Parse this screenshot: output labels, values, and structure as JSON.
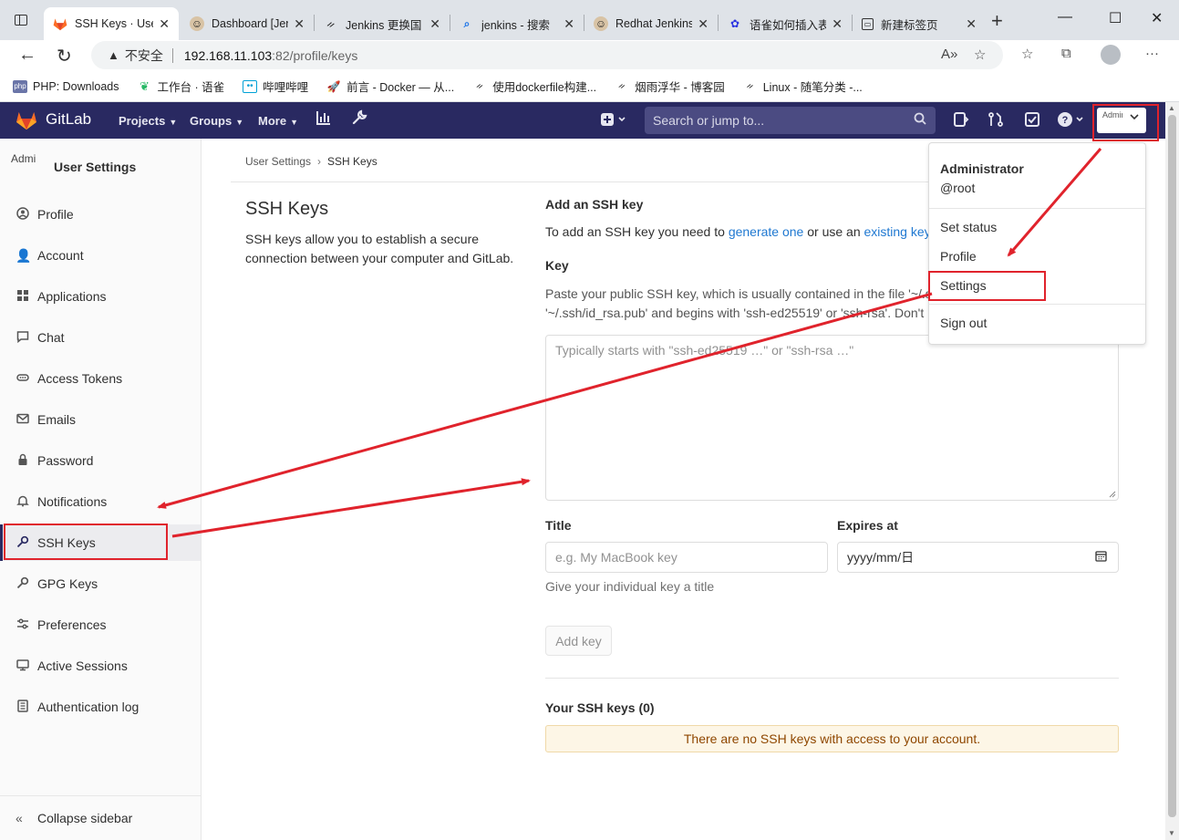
{
  "browser": {
    "tabs": [
      {
        "title": "SSH Keys · User",
        "icon": "gitlab-icon",
        "active": true
      },
      {
        "title": "Dashboard [Jen",
        "icon": "jenkins-icon",
        "active": false
      },
      {
        "title": "Jenkins 更换国",
        "icon": "yuque-icon",
        "active": false
      },
      {
        "title": "jenkins - 搜索",
        "icon": "search-icon",
        "active": false
      },
      {
        "title": "Redhat Jenkins",
        "icon": "jenkins-icon",
        "active": false
      },
      {
        "title": "语雀如何插入表",
        "icon": "baidu-icon",
        "active": false
      },
      {
        "title": "新建标签页",
        "icon": "newtab-icon",
        "active": false
      }
    ],
    "insecure_label": "不安全",
    "url_host": "192.168.11.103",
    "url_path": ":82/profile/keys",
    "bookmarks": [
      {
        "label": "PHP: Downloads",
        "icon": "php-icon"
      },
      {
        "label": "工作台 · 语雀",
        "icon": "yuque-icon"
      },
      {
        "label": "哔哩哔哩",
        "icon": "bilibili-icon"
      },
      {
        "label": "前言 - Docker — 从...",
        "icon": "rocket-icon"
      },
      {
        "label": "使用dockerfile构建...",
        "icon": "yuque-icon"
      },
      {
        "label": "烟雨浮华 - 博客园",
        "icon": "yuque-icon"
      },
      {
        "label": "Linux - 随笔分类 -...",
        "icon": "yuque-icon"
      }
    ]
  },
  "header": {
    "title": "GitLab",
    "nav": [
      "Projects",
      "Groups",
      "More"
    ],
    "search_placeholder": "Search or jump to...",
    "avatar_alt": "Admini",
    "brand_color": "#292961"
  },
  "sidebar": {
    "avatar_alt": "Admi",
    "title": "User Settings",
    "items": [
      {
        "label": "Profile",
        "icon": "profile-icon"
      },
      {
        "label": "Account",
        "icon": "account-icon"
      },
      {
        "label": "Applications",
        "icon": "applications-icon"
      },
      {
        "label": "Chat",
        "icon": "chat-icon"
      },
      {
        "label": "Access Tokens",
        "icon": "token-icon"
      },
      {
        "label": "Emails",
        "icon": "mail-icon"
      },
      {
        "label": "Password",
        "icon": "lock-icon"
      },
      {
        "label": "Notifications",
        "icon": "bell-icon"
      },
      {
        "label": "SSH Keys",
        "icon": "key-icon",
        "active": true
      },
      {
        "label": "GPG Keys",
        "icon": "key-icon"
      },
      {
        "label": "Preferences",
        "icon": "preferences-icon"
      },
      {
        "label": "Active Sessions",
        "icon": "monitor-icon"
      },
      {
        "label": "Authentication log",
        "icon": "log-icon"
      }
    ],
    "collapse_label": "Collapse sidebar"
  },
  "breadcrumb": {
    "parent": "User Settings",
    "current": "SSH Keys"
  },
  "main": {
    "title": "SSH Keys",
    "description": "SSH keys allow you to establish a secure connection between your computer and GitLab.",
    "add_heading": "Add an SSH key",
    "add_desc_pre": "To add an SSH key you need to ",
    "add_desc_link1": "generate one",
    "add_desc_mid": " or use an ",
    "add_desc_link2": "existing key",
    "add_desc_post": ".",
    "key_label": "Key",
    "key_help_line1": "Paste your public SSH key, which is usually contained in the file '~/.s",
    "key_help_line2": "'~/.ssh/id_rsa.pub' and begins with 'ssh-ed25519' or 'ssh-rsa'. Don't",
    "key_placeholder": "Typically starts with \"ssh-ed25519 …\" or \"ssh-rsa …\"",
    "title_label": "Title",
    "title_placeholder": "e.g. My MacBook key",
    "title_help": "Give your individual key a title",
    "expires_label": "Expires at",
    "expires_value": "yyyy/mm/日",
    "add_button": "Add key",
    "your_keys": "Your SSH keys (0)",
    "empty_message": "There are no SSH keys with access to your account."
  },
  "dropdown": {
    "name": "Administrator",
    "username": "@root",
    "items": [
      "Set status",
      "Profile",
      "Settings",
      "Sign out"
    ]
  },
  "annotation_color": "#e0232c"
}
